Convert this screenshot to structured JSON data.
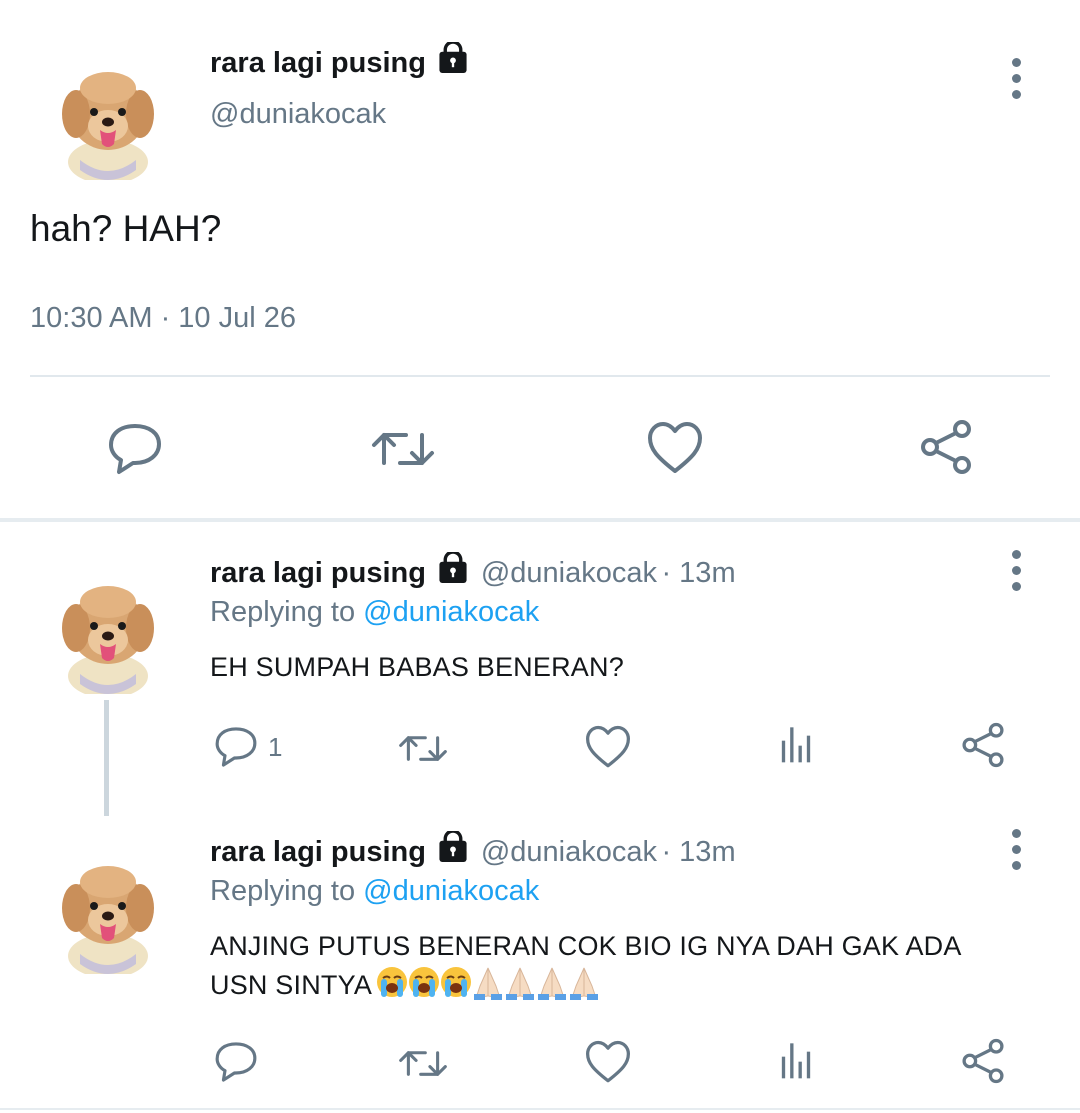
{
  "main_tweet": {
    "display_name": "rara lagi pusing",
    "handle": "@duniakocak",
    "text": "hah? HAH?",
    "timestamp": "10:30 AM · 10 Jul 26"
  },
  "reply_1": {
    "display_name": "rara lagi pusing",
    "handle": "@duniakocak",
    "time": "· 13m",
    "replying_label": "Replying to",
    "replying_handle": "@duniakocak",
    "text": "EH SUMPAH BABAS BENERAN?",
    "reply_count": "1"
  },
  "reply_2": {
    "display_name": "rara lagi pusing",
    "handle": "@duniakocak",
    "time": "· 13m",
    "replying_label": "Replying to",
    "replying_handle": "@duniakocak",
    "text_line1": "ANJING PUTUS BENERAN COK BIO IG NYA DAH GAK ADA",
    "text_line2": "USN SINTYA",
    "emojis": [
      "loudly-crying-face",
      "loudly-crying-face",
      "loudly-crying-face",
      "folded-hands",
      "folded-hands",
      "folded-hands",
      "folded-hands"
    ]
  },
  "colors": {
    "icon_gray": "#657786",
    "link_blue": "#1da1f2",
    "text": "#14171a",
    "divider": "#e1e8ed"
  }
}
